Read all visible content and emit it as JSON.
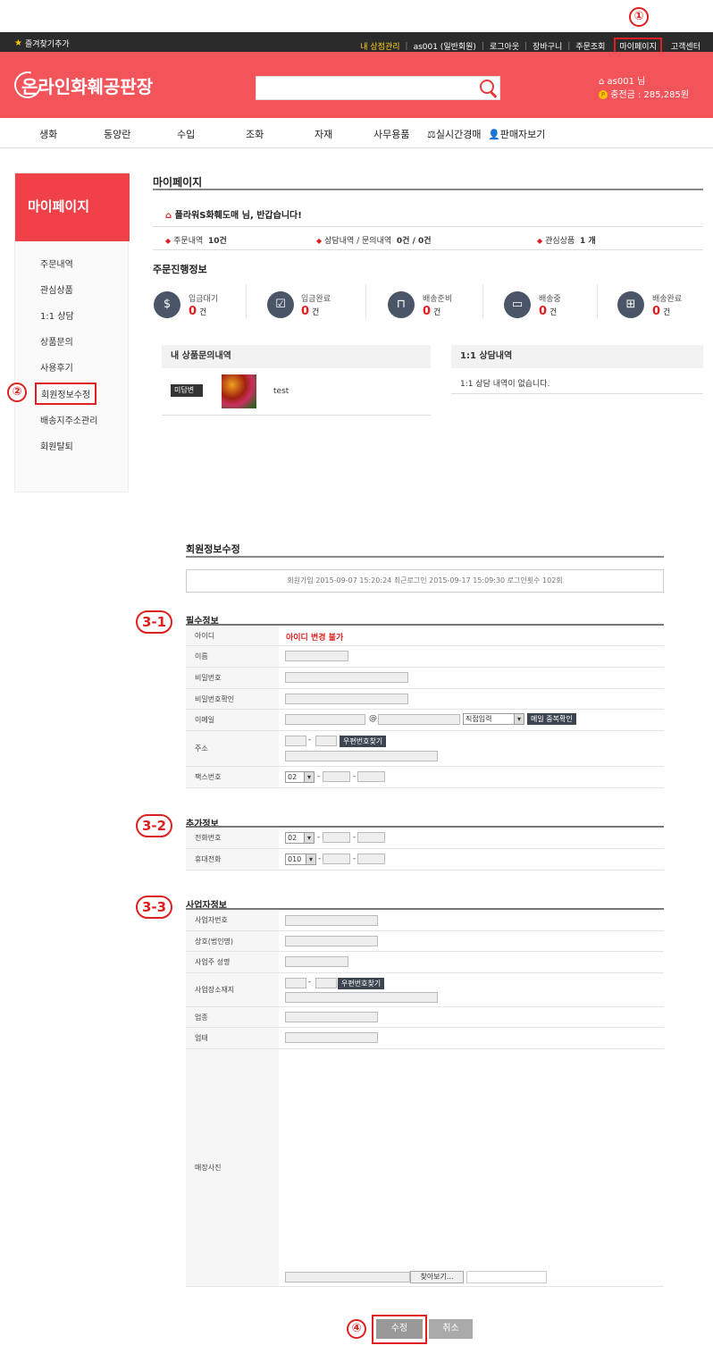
{
  "topbar": {
    "favorites": "즐겨찾기추가",
    "links": [
      "내 상점관리",
      "as001 (일반회원)",
      "로그아웃",
      "장바구니",
      "주문조회",
      "마이페이지",
      "고객센터"
    ]
  },
  "header": {
    "logo": "온라인화훼공판장",
    "user": "as001 님",
    "balance": "충전금 : 285,285원"
  },
  "nav": [
    "생화",
    "동양란",
    "수입",
    "조화",
    "자재",
    "사무용품",
    "실시간경매",
    "판매자보기"
  ],
  "sidebar": {
    "title": "마이페이지",
    "items": [
      "주문내역",
      "관심상품",
      "1:1 상담",
      "상품문의",
      "사용후기",
      "회원정보수정",
      "배송지주소관리",
      "회원탈퇴"
    ]
  },
  "mypage": {
    "title": "마이페이지",
    "greeting": "플라워S화훼도매 님, 반갑습니다!",
    "summary": {
      "orders_label": "주문내역",
      "orders_value": "10건",
      "inquiry_label": "상담내역 / 문의내역",
      "inquiry_value": "0건 / 0건",
      "wish_label": "관심상품",
      "wish_value": "1 개"
    },
    "progress_title": "주문진행정보",
    "progress": [
      {
        "label": "입금대기",
        "count": "0",
        "unit": "건",
        "icon": "money-bag-icon"
      },
      {
        "label": "입금완료",
        "count": "0",
        "unit": "건",
        "icon": "check-icon"
      },
      {
        "label": "배송준비",
        "count": "0",
        "unit": "건",
        "icon": "shopping-bag-icon"
      },
      {
        "label": "배송중",
        "count": "0",
        "unit": "건",
        "icon": "truck-icon"
      },
      {
        "label": "배송완료",
        "count": "0",
        "unit": "건",
        "icon": "gift-icon"
      }
    ],
    "qna_title": "내 상품문의내역",
    "qna_badge": "미답변",
    "qna_item": "test",
    "consult_title": "1:1 상담내역",
    "consult_empty": "1:1 상담 내역이 없습니다."
  },
  "form": {
    "title": "회원정보수정",
    "info_line": "회원가입 2015-09-07 15:20:24    최근로그인 2015-09-17 15:09:30    로그인횟수 102회",
    "required_title": "필수정보",
    "id_label": "아이디",
    "id_value": "아이디 변경 불가",
    "name_label": "이름",
    "pw_label": "비밀번호",
    "pw2_label": "비밀번호확인",
    "email_label": "이메일",
    "email_at": "@",
    "email_select": "직접입력",
    "email_check": "메일 중복확인",
    "addr_label": "주소",
    "zip_btn": "우편번호찾기",
    "fax_label": "팩스번호",
    "fax_prefix": "02",
    "extra_title": "추가정보",
    "tel_label": "전화번호",
    "tel_prefix": "02",
    "mobile_label": "휴대전화",
    "mobile_prefix": "010",
    "biz_title": "사업자정보",
    "biz_no_label": "사업자번호",
    "biz_name_label": "상호(법인명)",
    "biz_owner_label": "사업주 성명",
    "biz_addr_label": "사업장소재지",
    "biz_type_label": "업종",
    "biz_cat_label": "업태",
    "shop_photo_label": "매장사진",
    "browse_btn": "찾아보기...",
    "dash": "-",
    "submit": "수정",
    "cancel": "취소"
  },
  "annotations": [
    "①",
    "②",
    "3-1",
    "3-2",
    "3-3",
    "④"
  ],
  "colors": {
    "brand": "#f3545a",
    "sidebar_head": "#f04148",
    "highlight": "#e02020"
  }
}
